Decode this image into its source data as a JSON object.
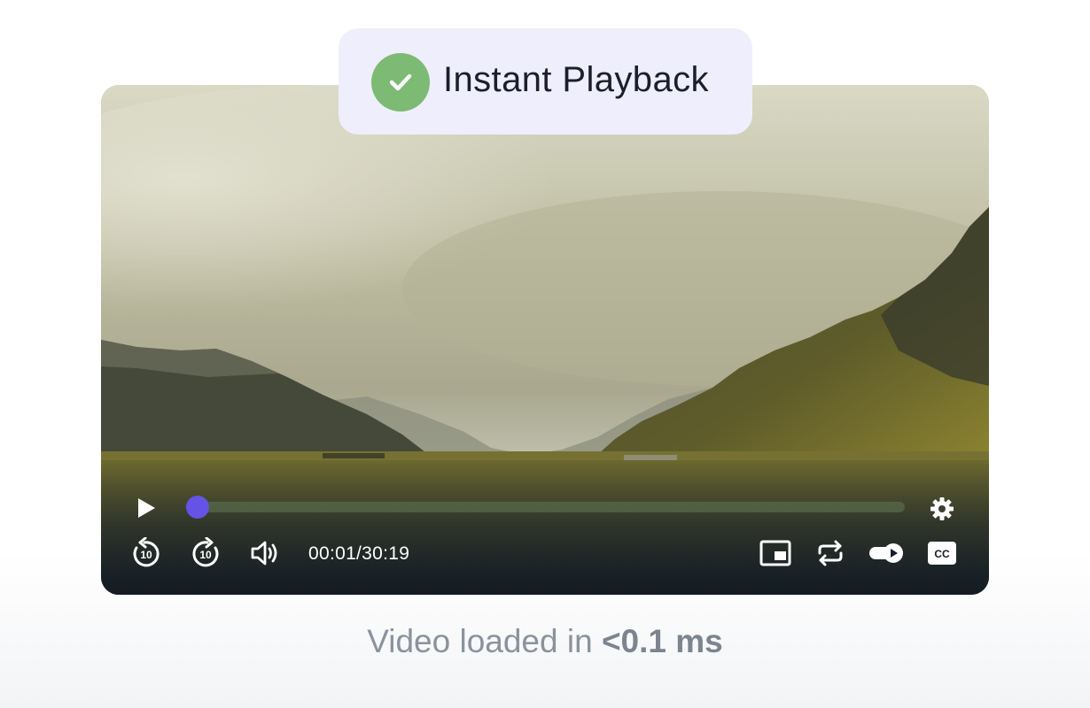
{
  "badge": {
    "icon": "check-circle-icon",
    "label": "Instant Playback",
    "icon_color": "#7dba74"
  },
  "player": {
    "progress": 0.0006,
    "accent_color": "#6453e6",
    "time_display": "00:01/30:19",
    "controls_left": [
      "play-icon",
      "rewind-10-icon",
      "forward-10-icon",
      "volume-icon"
    ],
    "controls_right": [
      "picture-in-picture-icon",
      "loop-icon",
      "autoplay-toggle-icon",
      "closed-captions-icon"
    ],
    "settings_icon": "gear-icon",
    "rewind_seconds": "10",
    "forward_seconds": "10",
    "cc_label": "CC"
  },
  "caption": {
    "prefix": "Video loaded in ",
    "value": "<0.1 ms"
  }
}
